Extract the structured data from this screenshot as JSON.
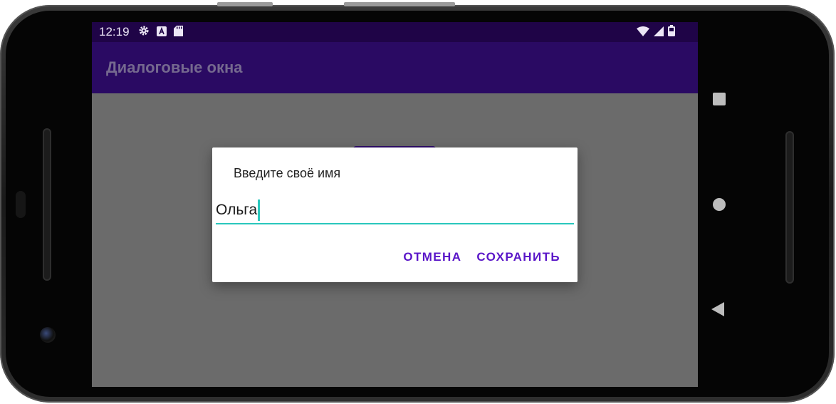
{
  "status_bar": {
    "time": "12:19",
    "left_icons": [
      "gear-icon",
      "a-box-icon",
      "sd-card-icon"
    ],
    "right_icons": [
      "wifi-icon",
      "signal-icon",
      "battery-icon"
    ]
  },
  "app_bar": {
    "title": "Диалоговые окна"
  },
  "dialog": {
    "title": "Введите своё имя",
    "input_value": "Ольга",
    "cancel_label": "ОТМЕНА",
    "save_label": "СОХРАНИТЬ"
  },
  "nav": {
    "buttons": [
      "overview-square-icon",
      "home-circle-icon",
      "back-triangle-icon"
    ]
  },
  "colors": {
    "status_bar": "#1f0447",
    "app_bar": "#2a0a63",
    "scrim": "#6b6b6b",
    "accent": "#29c7bd",
    "button_text": "#5a16c8"
  }
}
